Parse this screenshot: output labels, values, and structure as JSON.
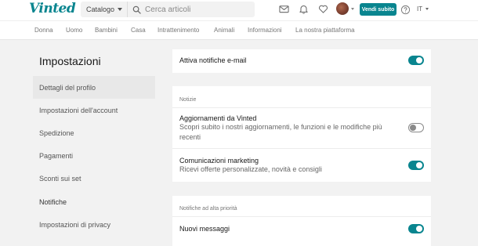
{
  "header": {
    "logo": "Vinted",
    "catalog_label": "Catalogo",
    "search_placeholder": "Cerca articoli",
    "sell_button": "Vendi subito",
    "language": "IT"
  },
  "category_nav": [
    "Donna",
    "Uomo",
    "Bambini",
    "Casa",
    "Intrattenimento",
    "Animali",
    "Informazioni",
    "La nostra piattaforma"
  ],
  "sidebar": {
    "title": "Impostazioni",
    "items": [
      {
        "label": "Dettagli del profilo",
        "active": true
      },
      {
        "label": "Impostazioni dell'account"
      },
      {
        "label": "Spedizione"
      },
      {
        "label": "Pagamenti"
      },
      {
        "label": "Sconti sui set"
      },
      {
        "label": "Notifiche"
      },
      {
        "label": "Impostazioni di privacy"
      }
    ]
  },
  "settings": {
    "email_notifications": {
      "label": "Attiva notifiche e-mail",
      "enabled": true
    },
    "notizie": {
      "section_label": "Notizie",
      "updates": {
        "title": "Aggiornamenti da Vinted",
        "description": "Scopri subito i nostri aggiornamenti, le funzioni e le modifiche più recenti",
        "enabled": false
      },
      "marketing": {
        "title": "Comunicazioni marketing",
        "description": "Ricevi offerte personalizzate, novità e consigli",
        "enabled": true
      }
    },
    "high_priority": {
      "section_label": "Notifiche ad alta priorità",
      "new_messages": {
        "title": "Nuovi messaggi",
        "enabled": true
      }
    }
  },
  "colors": {
    "accent": "#09858f",
    "background": "#f2f2f2",
    "toggle_off": "#8a8a8a"
  },
  "icons": [
    "search-icon",
    "mail-icon",
    "bell-icon",
    "heart-icon",
    "help-icon"
  ]
}
